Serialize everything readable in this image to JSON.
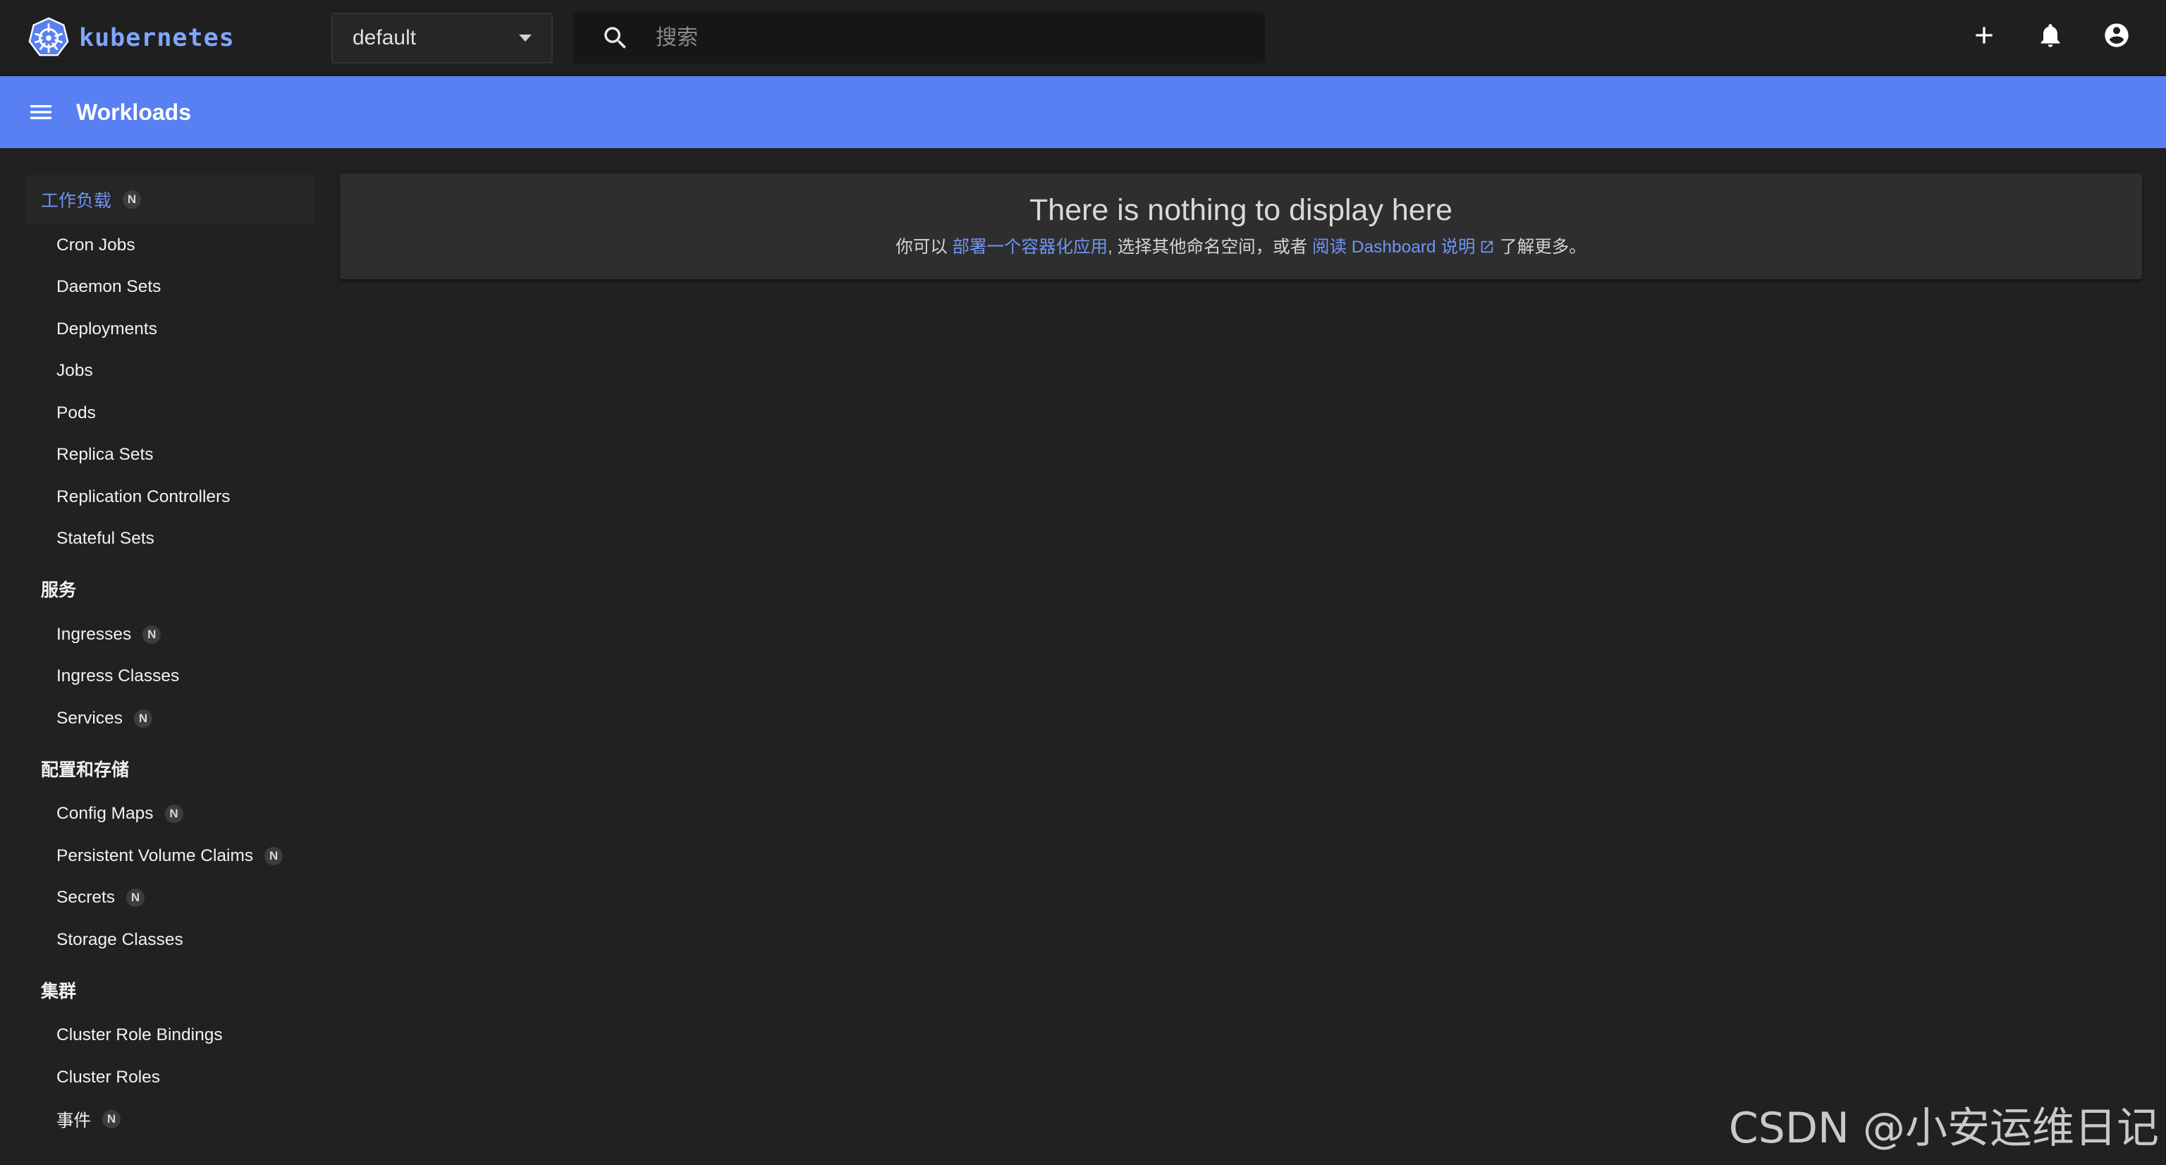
{
  "header": {
    "brand": "kubernetes",
    "namespace": "default",
    "search_placeholder": "搜索"
  },
  "titlebar": {
    "title": "Workloads"
  },
  "sidebar": {
    "workloads": {
      "label": "工作负载",
      "badge": "N",
      "items": [
        "Cron Jobs",
        "Daemon Sets",
        "Deployments",
        "Jobs",
        "Pods",
        "Replica Sets",
        "Replication Controllers",
        "Stateful Sets"
      ]
    },
    "services": {
      "label": "服务",
      "items": [
        {
          "label": "Ingresses",
          "badge": "N"
        },
        {
          "label": "Ingress Classes",
          "badge": ""
        },
        {
          "label": "Services",
          "badge": "N"
        }
      ]
    },
    "config": {
      "label": "配置和存储",
      "items": [
        {
          "label": "Config Maps",
          "badge": "N"
        },
        {
          "label": "Persistent Volume Claims",
          "badge": "N"
        },
        {
          "label": "Secrets",
          "badge": "N"
        },
        {
          "label": "Storage Classes",
          "badge": ""
        }
      ]
    },
    "cluster": {
      "label": "集群",
      "items": [
        {
          "label": "Cluster Role Bindings",
          "badge": ""
        },
        {
          "label": "Cluster Roles",
          "badge": ""
        },
        {
          "label": "事件",
          "badge": "N"
        }
      ]
    }
  },
  "main": {
    "heading": "There is nothing to display here",
    "text_prefix": "你可以",
    "link_deploy": "部署一个容器化应用",
    "text_middle": ", 选择其他命名空间，或者",
    "link_docs": "阅读 Dashboard 说明",
    "text_suffix": "了解更多。"
  },
  "watermark": "CSDN @小安运维日记",
  "colors": {
    "accent": "#5880f2",
    "link": "#6f95f6",
    "background": "#212121"
  }
}
